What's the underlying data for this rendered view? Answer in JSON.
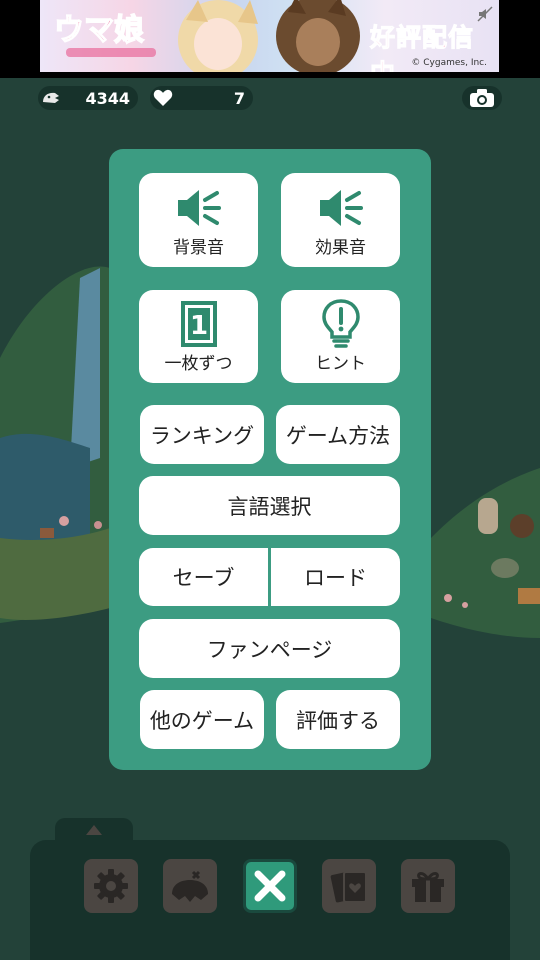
{
  "ad": {
    "promo_text": "好評配信中",
    "copyright": "© Cygames, Inc."
  },
  "stats": {
    "coins": "4344",
    "lives": "7"
  },
  "menu": {
    "bgm_label": "背景音",
    "sfx_label": "効果音",
    "one_by_one_label": "一枚ずつ",
    "one_by_one_number": "1",
    "hint_label": "ヒント",
    "ranking_label": "ランキング",
    "howto_label": "ゲーム方法",
    "language_label": "言語選択",
    "save_label": "セーブ",
    "load_label": "ロード",
    "fanpage_label": "ファンページ",
    "other_games_label": "他のゲーム",
    "rate_label": "評価する"
  },
  "colors": {
    "panel": "#3c9c82",
    "icon_green": "#2f8a6e",
    "toolbar": "#17322b"
  },
  "icons": {
    "bgm": "speaker-icon",
    "sfx": "speaker-icon",
    "hint": "lightbulb-icon",
    "camera": "camera-icon",
    "coins": "coin-icon",
    "lives": "heart-icon",
    "toolbar": [
      "gear-icon",
      "island-icon",
      "close-icon",
      "cards-icon",
      "gift-icon"
    ]
  }
}
